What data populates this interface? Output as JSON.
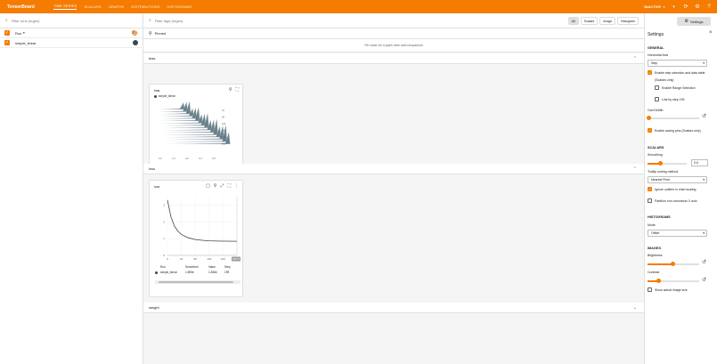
{
  "topbar": {
    "brand": "TensorBoard",
    "tabs": [
      "TIME SERIES",
      "SCALARS",
      "GRAPHS",
      "DISTRIBUTIONS",
      "HISTOGRAMS"
    ],
    "status": "INACTIVE",
    "color": "#f57c00"
  },
  "runs": {
    "search_placeholder": "Filter runs (regex)",
    "header": "Run",
    "items": [
      {
        "name": "simple_linear",
        "color": "#37474f"
      }
    ]
  },
  "main": {
    "search_placeholder": "Filter tags (regex)",
    "type_buttons": [
      "All",
      "Scalars",
      "Image",
      "Histogram"
    ],
    "settings_label": "Settings",
    "pinned_label": "Pinned",
    "pinned_note": "Pin cards for a quick view and comparison",
    "groups": [
      {
        "name": "bias",
        "card": {
          "title": "bias",
          "legend": "simple_linear",
          "y_ticks": [
            "10",
            "50",
            "100",
            "200",
            "500",
            "800"
          ],
          "x_ticks": [
            "0.0",
            "0.1",
            "0.2",
            "0.4",
            "0.5"
          ]
        }
      },
      {
        "name": "loss",
        "card": {
          "title": "loss",
          "y_ticks": [
            "3",
            "2",
            "1",
            "0"
          ],
          "x_ticks": [
            "0",
            "40",
            "80",
            "120",
            "160",
            "199.76"
          ],
          "table_headers": [
            "Run",
            "Smoothed",
            "Value",
            "Step"
          ],
          "table_row": {
            "run": "simple_linear",
            "smoothed": "1.895e",
            "value": "1.836e",
            "step": "199"
          }
        }
      },
      {
        "name": "weight"
      }
    ]
  },
  "chart_data": {
    "type": "line",
    "x": [
      0,
      10,
      20,
      30,
      40,
      60,
      80,
      100,
      120,
      160,
      199.76
    ],
    "series": [
      {
        "values": [
          3.3,
          2.3,
          1.75,
          1.45,
          1.25,
          1.05,
          0.95,
          0.9,
          0.87,
          0.85,
          0.84
        ]
      }
    ],
    "xlim": [
      0,
      200
    ],
    "ylim": [
      0,
      3.5
    ]
  },
  "settings": {
    "title": "Settings",
    "general": "GENERAL",
    "horizontal_axis_label": "Horizontal Axis",
    "horizontal_axis_value": "Step",
    "enable_step_selection": "Enable step selection and data table",
    "scalars_only": "(Scalars only)",
    "enable_range_selection": "Enable Range Selection",
    "link_by_step": "Link by step 199",
    "card_width_label": "Card Width",
    "enable_pinning": "Enable saving pins (Scalars only)",
    "scalars": "SCALARS",
    "smoothing_label": "Smoothing",
    "smoothing_value": "0.6",
    "tooltip_sorting_label": "Tooltip sorting method",
    "tooltip_sorting_value": "Nearest Pixel",
    "ignore_outliers": "Ignore outliers in chart scaling",
    "partition_nonmonotonic": "Partition non-monotonic X axis",
    "histograms": "HISTOGRAMS",
    "mode_label": "Mode",
    "mode_value": "Offset",
    "images": "IMAGES",
    "brightness_label": "Brightness",
    "contrast_label": "Contrast",
    "show_actual_size": "Show actual image size"
  }
}
